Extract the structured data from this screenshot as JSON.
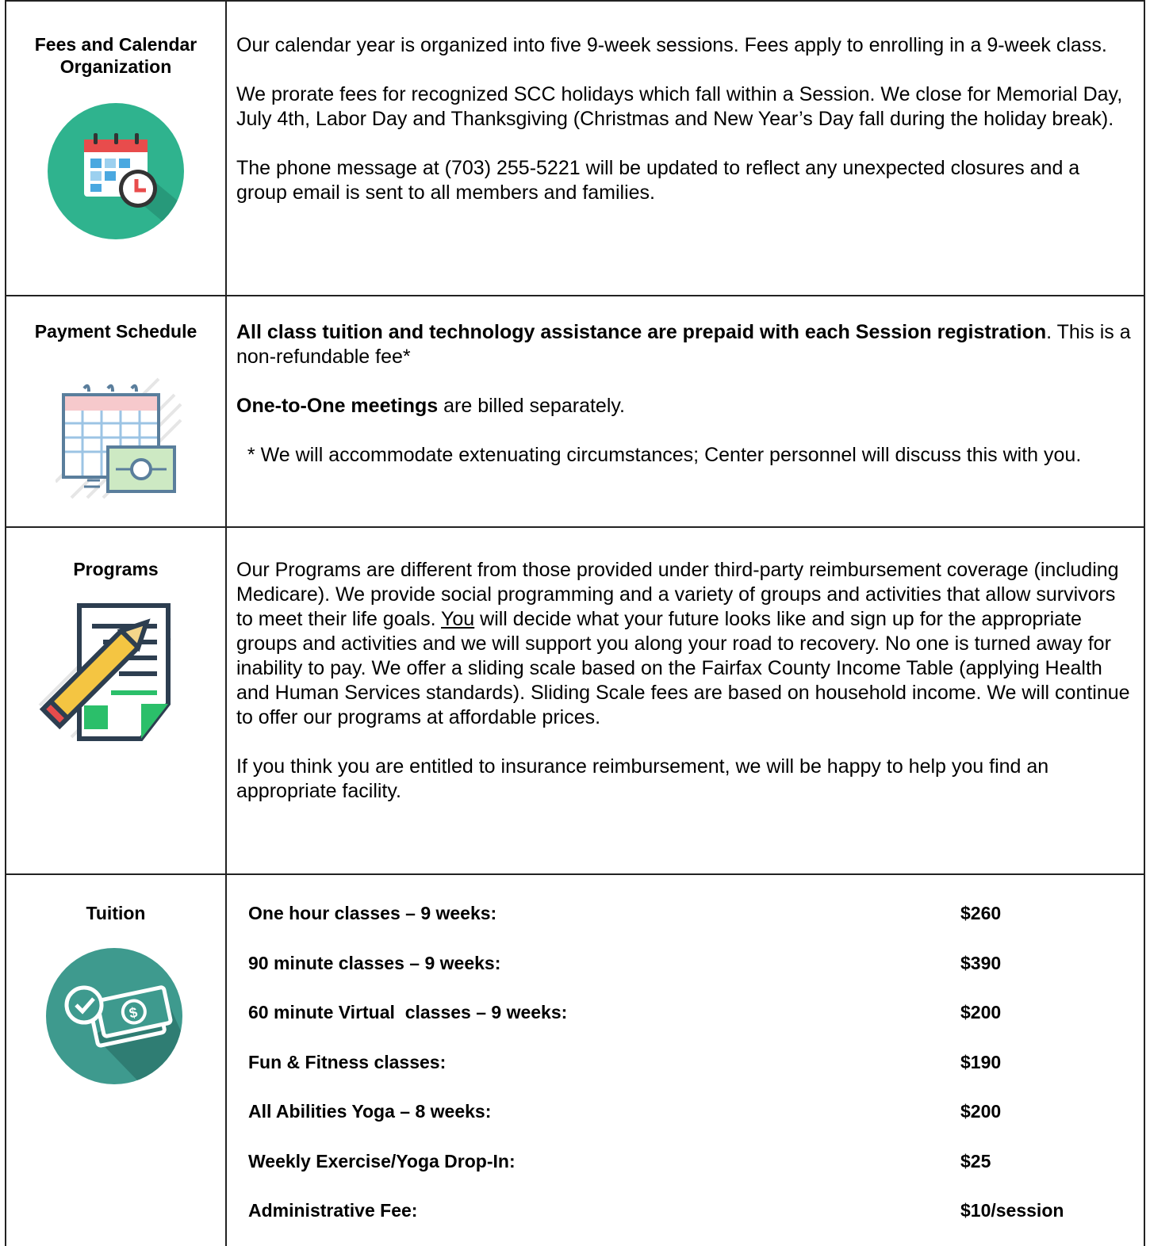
{
  "sections": [
    {
      "label": "Fees and Calendar Organization",
      "icon": "calendar-clock-icon",
      "paragraphs": [
        "Our calendar year is organized into five 9-week sessions.  Fees apply to enrolling in a 9-week class.",
        "We prorate fees for recognized SCC holidays which fall within a Session. We close for Memorial Day, July 4th, Labor Day and Thanksgiving (Christmas and New Year’s Day fall during the holiday break).",
        "The phone message at (703) 255-5221 will be updated to reflect any unexpected closures and a group email is sent to all members and families."
      ]
    },
    {
      "label": "Payment Schedule",
      "icon": "calendar-payment-icon",
      "p1_bold": "All class tuition and technology assistance are prepaid with each Session registration",
      "p1_rest": ".  This is a non-refundable fee*",
      "p2_bold": "One-to-One meetings",
      "p2_rest": " are billed separately.",
      "p3": "  * We will accommodate extenuating circumstances; Center personnel will discuss this with you."
    },
    {
      "label": "Programs",
      "icon": "document-pencil-icon",
      "p1_a": "Our Programs are different from those provided under third-party reimbursement coverage (including Medicare). We provide social programming and a variety of groups and activities that allow survivors to meet their life goals.  ",
      "p1_u": "You",
      "p1_b": " will decide what your future looks like and sign up for the appropriate groups and activities and we will support you along your road to recovery.  No one is turned away for inability to pay. We offer a sliding scale based on the Fairfax County Income Table (applying Health and Human Services standards). Sliding Scale fees are based on household income. We will continue to offer our programs at affordable prices.",
      "p2": "If you think you are entitled to insurance reimbursement, we will be happy to help you find an appropriate facility."
    },
    {
      "label": "Tuition",
      "icon": "money-check-icon",
      "rows": [
        {
          "name": "One hour classes – 9 weeks:",
          "price": "$260"
        },
        {
          "name": "90 minute classes – 9 weeks:",
          "price": "$390"
        },
        {
          "name": "60 minute Virtual  classes – 9 weeks:",
          "price": "$200"
        },
        {
          "name": "Fun & Fitness classes:",
          "price": "$190"
        },
        {
          "name": "All Abilities Yoga – 8 weeks:",
          "price": "$200"
        },
        {
          "name": "Weekly Exercise/Yoga Drop-In:",
          "price": "$25"
        },
        {
          "name": "Administrative Fee:",
          "price": "$10/session"
        }
      ]
    }
  ],
  "colors": {
    "teal": "#2fb38e",
    "tuition_teal": "#3e9a8e",
    "accent_red": "#e84c4c",
    "accent_green": "#2bbf6a",
    "pencil_yellow": "#f4c542"
  }
}
